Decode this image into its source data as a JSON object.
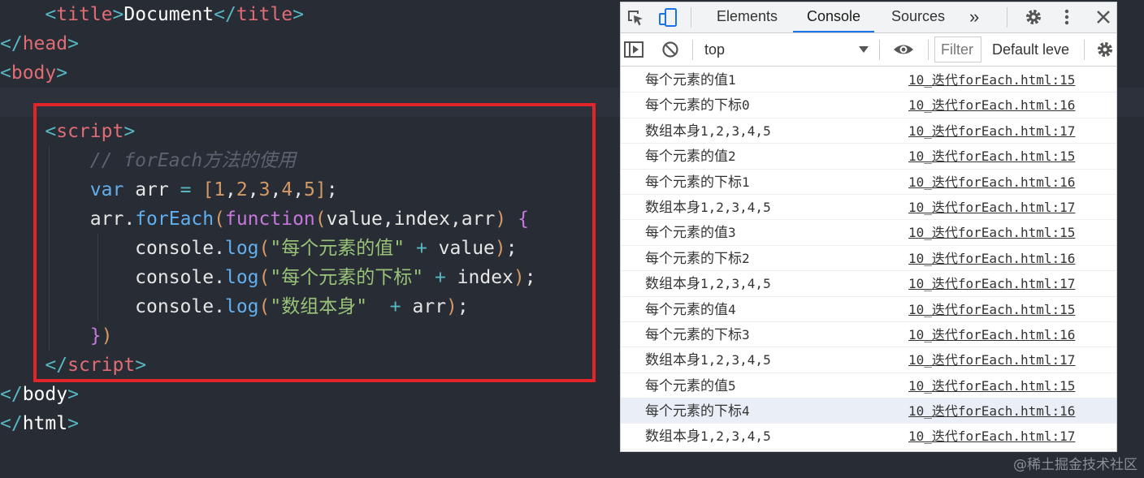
{
  "editor": {
    "lines": {
      "title_text": "Document",
      "title_tag": "title",
      "head_tag": "head",
      "body_tag": "body",
      "script_tag": "script",
      "html_tag": "html",
      "comment": "// forEach方法的使用",
      "kw_var": "var",
      "arr": "arr",
      "nums": [
        "1",
        "2",
        "3",
        "4",
        "5"
      ],
      "forEach": "forEach",
      "function": "function",
      "params": "value,index,arr",
      "console": "console",
      "log": "log",
      "str1": "\"每个元素的值\"",
      "str2": "\"每个元素的下标\"",
      "str3": "\"数组本身\"",
      "value": "value",
      "index": "index"
    }
  },
  "devtools": {
    "tabs": {
      "elements": "Elements",
      "console": "Console",
      "sources": "Sources",
      "more": "»"
    },
    "toolbar": {
      "context": "top",
      "filter_placeholder": "Filter",
      "level": "Default leve"
    },
    "rows": [
      {
        "msg": "每个元素的值",
        "num": "1",
        "src": "10_迭代forEach.html:15"
      },
      {
        "msg": "每个元素的下标",
        "num": "0",
        "src": "10_迭代forEach.html:16"
      },
      {
        "msg": "数组本身",
        "num": "1,2,3,4,5",
        "src": "10_迭代forEach.html:17"
      },
      {
        "msg": "每个元素的值",
        "num": "2",
        "src": "10_迭代forEach.html:15"
      },
      {
        "msg": "每个元素的下标",
        "num": "1",
        "src": "10_迭代forEach.html:16"
      },
      {
        "msg": "数组本身",
        "num": "1,2,3,4,5",
        "src": "10_迭代forEach.html:17"
      },
      {
        "msg": "每个元素的值",
        "num": "3",
        "src": "10_迭代forEach.html:15"
      },
      {
        "msg": "每个元素的下标",
        "num": "2",
        "src": "10_迭代forEach.html:16"
      },
      {
        "msg": "数组本身",
        "num": "1,2,3,4,5",
        "src": "10_迭代forEach.html:17"
      },
      {
        "msg": "每个元素的值",
        "num": "4",
        "src": "10_迭代forEach.html:15"
      },
      {
        "msg": "每个元素的下标",
        "num": "3",
        "src": "10_迭代forEach.html:16"
      },
      {
        "msg": "数组本身",
        "num": "1,2,3,4,5",
        "src": "10_迭代forEach.html:17"
      },
      {
        "msg": "每个元素的值",
        "num": "5",
        "src": "10_迭代forEach.html:15"
      },
      {
        "msg": "每个元素的下标",
        "num": "4",
        "src": "10_迭代forEach.html:16"
      },
      {
        "msg": "数组本身",
        "num": "1,2,3,4,5",
        "src": "10_迭代forEach.html:17"
      }
    ]
  },
  "watermark": "@稀土掘金技术社区",
  "colors": {
    "highlight_box": "#e3242b",
    "editor_bg": "#282c34",
    "tab_active": "#1a73e8"
  }
}
